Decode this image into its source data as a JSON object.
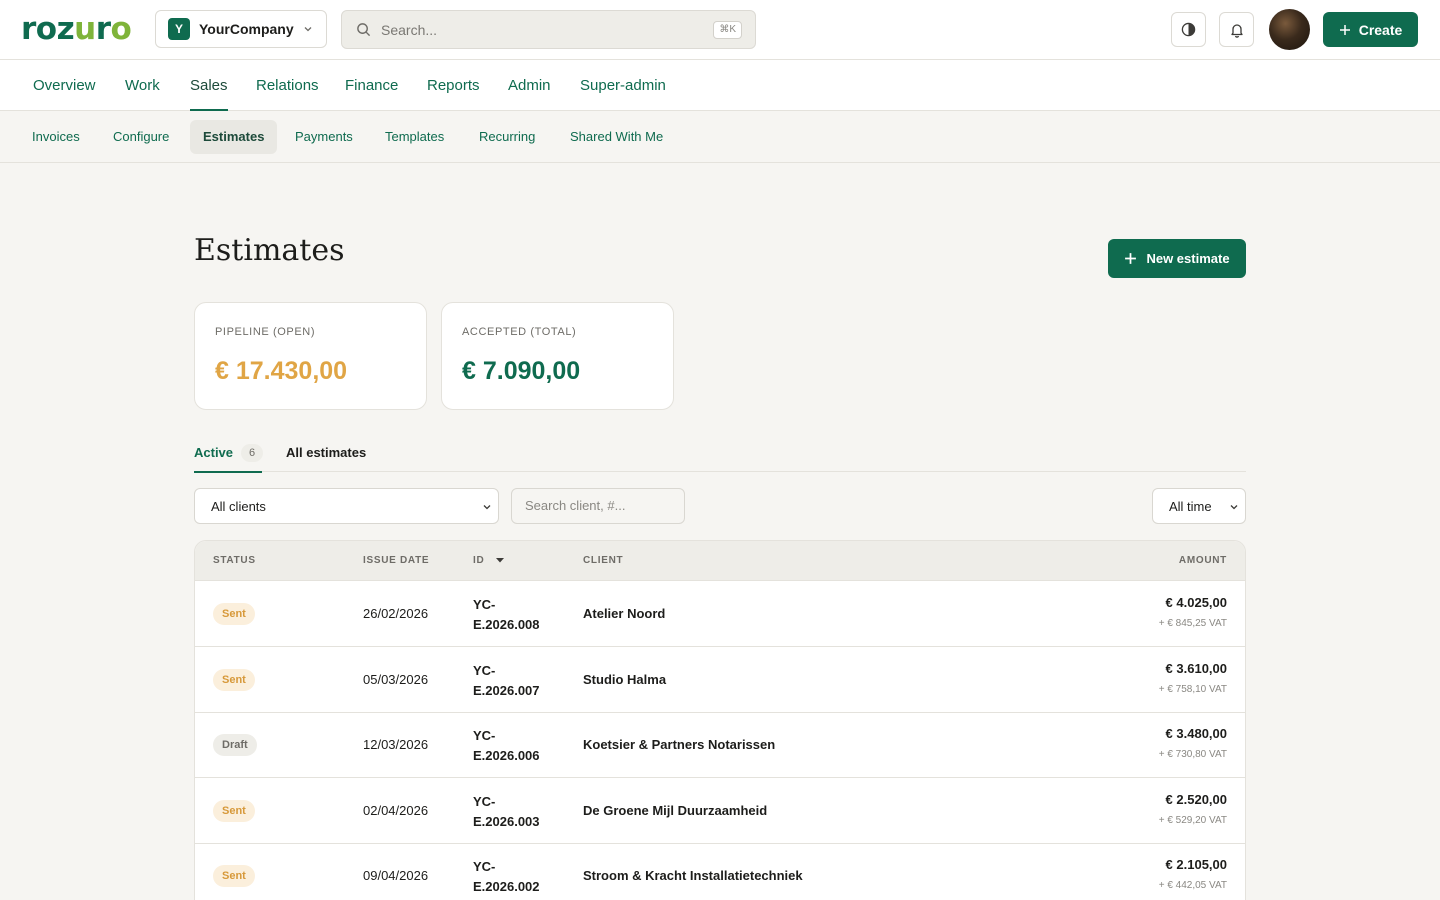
{
  "app": {
    "logo_text": "rozuro",
    "logo_part1": "roz",
    "logo_part2": "u",
    "logo_part3": "r",
    "logo_part4": "o"
  },
  "company": {
    "initial": "Y",
    "name": "YourCompany"
  },
  "search": {
    "placeholder": "Search...",
    "shortcut": "⌘K"
  },
  "header": {
    "create_label": "Create"
  },
  "main_nav": [
    {
      "label": "Overview"
    },
    {
      "label": "Work"
    },
    {
      "label": "Sales"
    },
    {
      "label": "Relations"
    },
    {
      "label": "Finance"
    },
    {
      "label": "Reports"
    },
    {
      "label": "Admin"
    },
    {
      "label": "Super-admin"
    }
  ],
  "main_nav_active": "Sales",
  "sub_nav": [
    {
      "label": "Invoices"
    },
    {
      "label": "Configure"
    },
    {
      "label": "Estimates"
    },
    {
      "label": "Payments"
    },
    {
      "label": "Templates"
    },
    {
      "label": "Recurring"
    },
    {
      "label": "Shared With Me"
    }
  ],
  "sub_nav_active": "Estimates",
  "page": {
    "title": "Estimates",
    "new_button": "New estimate"
  },
  "stats": {
    "pipeline": {
      "label": "PIPELINE (OPEN)",
      "value": "€ 17.430,00",
      "color": "#e0a545"
    },
    "accepted": {
      "label": "ACCEPTED (TOTAL)",
      "value": "€ 7.090,00",
      "color": "#0f6b4f"
    }
  },
  "tabs": {
    "active": {
      "label": "Active",
      "count": "6"
    },
    "all": {
      "label": "All estimates"
    }
  },
  "filters": {
    "client_select": "All clients",
    "search_placeholder": "Search client, #...",
    "period_select": "All time"
  },
  "table": {
    "headers": {
      "status": "STATUS",
      "issue_date": "ISSUE DATE",
      "id": "ID",
      "client": "CLIENT",
      "amount": "AMOUNT"
    },
    "rows": [
      {
        "status": "Sent",
        "date": "26/02/2026",
        "id_line1": "YC-",
        "id_line2": "E.2026.008",
        "client": "Atelier Noord",
        "amount": "€ 4.025,00",
        "vat": "+ € 845,25 VAT"
      },
      {
        "status": "Sent",
        "date": "05/03/2026",
        "id_line1": "YC-",
        "id_line2": "E.2026.007",
        "client": "Studio Halma",
        "amount": "€ 3.610,00",
        "vat": "+ € 758,10 VAT"
      },
      {
        "status": "Draft",
        "date": "12/03/2026",
        "id_line1": "YC-",
        "id_line2": "E.2026.006",
        "client": "Koetsier & Partners Notarissen",
        "amount": "€ 3.480,00",
        "vat": "+ € 730,80 VAT"
      },
      {
        "status": "Sent",
        "date": "02/04/2026",
        "id_line1": "YC-",
        "id_line2": "E.2026.003",
        "client": "De Groene Mijl Duurzaamheid",
        "amount": "€ 2.520,00",
        "vat": "+ € 529,20 VAT"
      },
      {
        "status": "Sent",
        "date": "09/04/2026",
        "id_line1": "YC-",
        "id_line2": "E.2026.002",
        "client": "Stroom & Kracht Installatietechniek",
        "amount": "€ 2.105,00",
        "vat": "+ € 442,05 VAT"
      }
    ]
  },
  "icons": {
    "search": "search-icon",
    "chevron": "chevron-down-icon",
    "theme": "contrast-icon",
    "bell": "bell-icon",
    "plus": "plus-icon",
    "sort": "sort-down-icon"
  },
  "colors": {
    "brand": "#0f6b4f",
    "brand_accent": "#7fb43a",
    "sent": "#d7993a",
    "draft": "#6e6c67"
  }
}
